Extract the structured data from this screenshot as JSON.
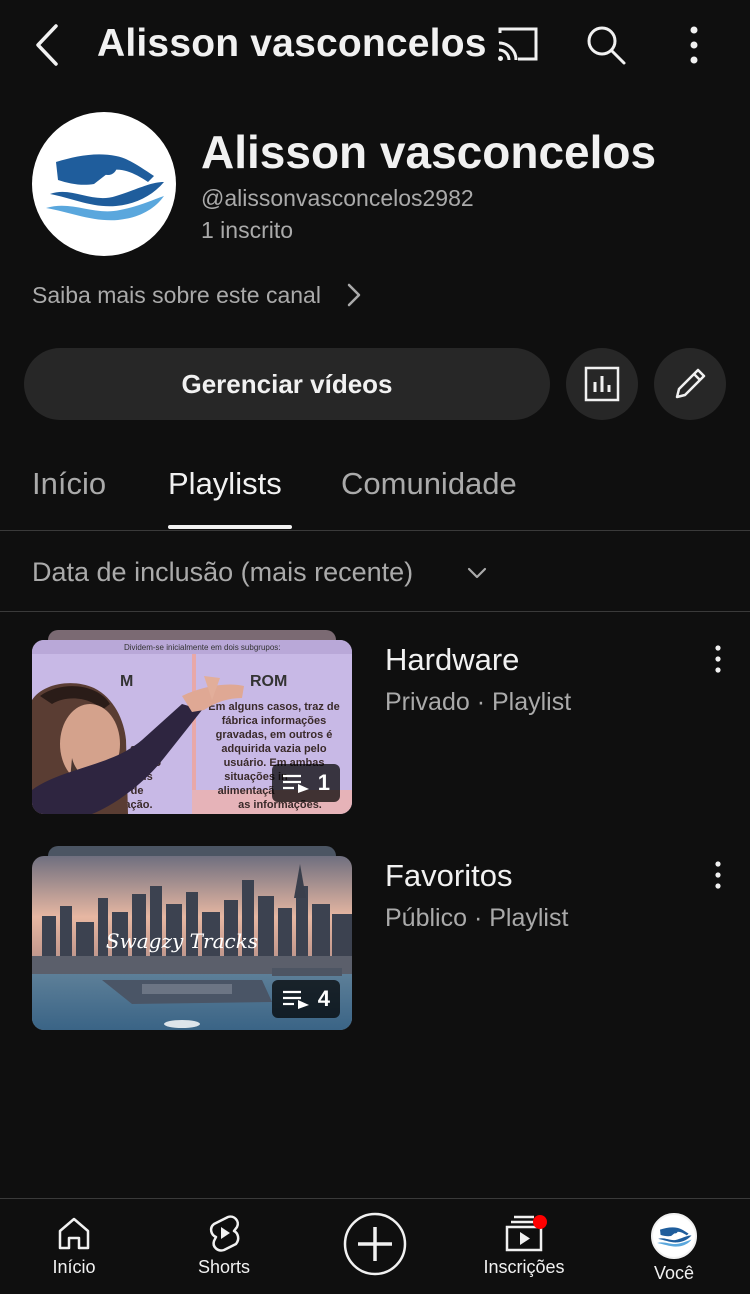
{
  "header": {
    "title": "Alisson vasconcelos"
  },
  "channel": {
    "name": "Alisson vasconcelos",
    "handle": "@alissonvasconcelos2982",
    "subscribers": "1 inscrito",
    "about_link": "Saiba mais sobre este canal",
    "manage_button": "Gerenciar vídeos"
  },
  "tabs": [
    {
      "label": "Início",
      "active": false
    },
    {
      "label": "Playlists",
      "active": true
    },
    {
      "label": "Comunidade",
      "active": false
    }
  ],
  "sort": {
    "label": "Data de inclusão (mais recente)"
  },
  "playlists": [
    {
      "title": "Hardware",
      "subtitle": "Privado · Playlist",
      "count": "1",
      "thumb_text": {
        "top": "Dividem-se inicialmente em dois subgrupos:",
        "left_heading": "M",
        "right_heading": "ROM",
        "right_body": "Em alguns casos, traz de fábrica informações gravadas, em outros é adquirida vazia pelo usuário. Em ambas situações in... alimentaçã... as informações.",
        "left_body": "até movido , pois nde de ntação."
      }
    },
    {
      "title": "Favoritos",
      "subtitle": "Público · Playlist",
      "count": "4",
      "thumb_text": {
        "logo": "Swagzy Tracks"
      }
    }
  ],
  "bottom_nav": [
    {
      "label": "Início",
      "icon": "home-icon"
    },
    {
      "label": "Shorts",
      "icon": "shorts-icon"
    },
    {
      "label": "",
      "icon": "create-icon"
    },
    {
      "label": "Inscrições",
      "icon": "subscriptions-icon"
    },
    {
      "label": "Você",
      "icon": "avatar"
    }
  ],
  "colors": {
    "background": "#0f0f0f",
    "surface": "#272727",
    "text_primary": "#f1f1f1",
    "text_secondary": "#aaaaaa",
    "notification": "#ff0000",
    "logo_blue": "#1f5d9c"
  }
}
